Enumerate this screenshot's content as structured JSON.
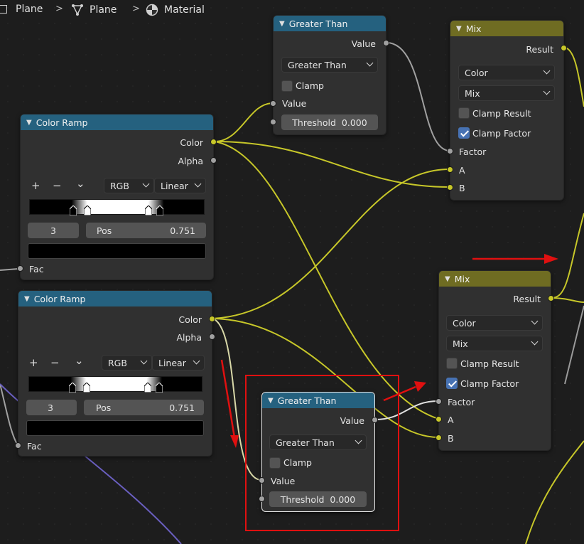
{
  "breadcrumb": {
    "items": [
      {
        "label": "Plane",
        "icon": "object-icon"
      },
      {
        "label": "Plane",
        "icon": "mesh-icon"
      },
      {
        "label": "Material",
        "icon": "material-icon"
      }
    ],
    "separator": ">"
  },
  "nodes": {
    "gt_top": {
      "title": "Greater Than",
      "output": "Value",
      "operation": "Greater Than",
      "clamp_label": "Clamp",
      "clamp_checked": false,
      "input_label": "Value",
      "threshold_label": "Threshold",
      "threshold_value": "0.000"
    },
    "ramp_top": {
      "title": "Color Ramp",
      "out_color": "Color",
      "out_alpha": "Alpha",
      "btn_add": "+",
      "btn_remove": "−",
      "btn_menu": "⌄",
      "color_mode": "RGB",
      "interpolation": "Linear",
      "active_index": "3",
      "pos_label": "Pos",
      "pos_value": "0.751",
      "in_fac": "Fac"
    },
    "ramp_bottom": {
      "title": "Color Ramp",
      "out_color": "Color",
      "out_alpha": "Alpha",
      "btn_add": "+",
      "btn_remove": "−",
      "btn_menu": "⌄",
      "color_mode": "RGB",
      "interpolation": "Linear",
      "active_index": "3",
      "pos_label": "Pos",
      "pos_value": "0.751",
      "in_fac": "Fac"
    },
    "mix_top": {
      "title": "Mix",
      "output": "Result",
      "data_type": "Color",
      "blend": "Mix",
      "clamp_result_label": "Clamp Result",
      "clamp_result_checked": false,
      "clamp_factor_label": "Clamp Factor",
      "clamp_factor_checked": true,
      "in_factor": "Factor",
      "in_a": "A",
      "in_b": "B"
    },
    "mix_bottom": {
      "title": "Mix",
      "output": "Result",
      "data_type": "Color",
      "blend": "Mix",
      "clamp_result_label": "Clamp Result",
      "clamp_result_checked": false,
      "clamp_factor_label": "Clamp Factor",
      "clamp_factor_checked": true,
      "in_factor": "Factor",
      "in_a": "A",
      "in_b": "B"
    },
    "gt_bottom": {
      "title": "Greater Than",
      "output": "Value",
      "operation": "Greater Than",
      "clamp_label": "Clamp",
      "clamp_checked": false,
      "input_label": "Value",
      "threshold_label": "Threshold",
      "threshold_value": "0.000"
    }
  },
  "colors": {
    "header_converter": "#25617f",
    "header_mix": "#6f6c22",
    "socket_color": "#c7c729",
    "socket_float": "#a1a1a1",
    "annotation": "#e01010",
    "checkbox_on": "#4772b3"
  }
}
